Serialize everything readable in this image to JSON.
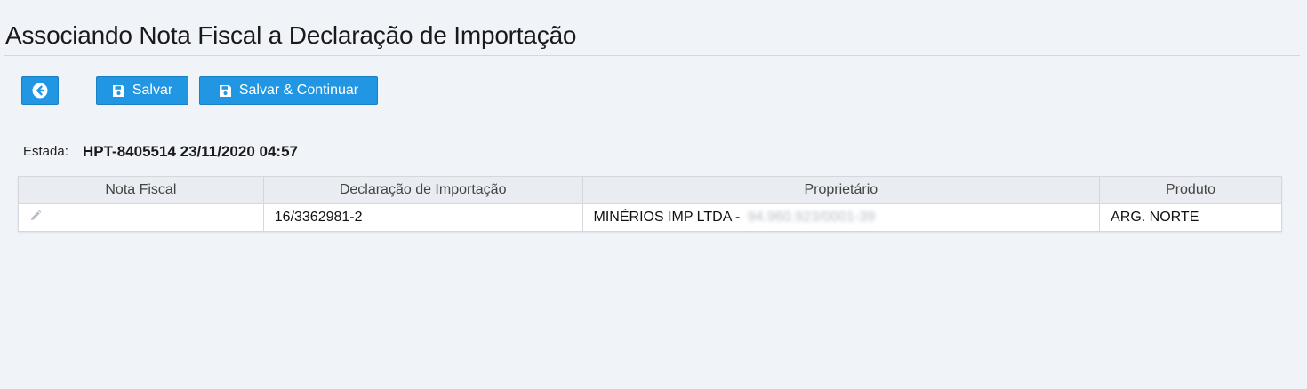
{
  "header": {
    "title": "Associando Nota Fiscal a Declaração de Importação"
  },
  "toolbar": {
    "back_icon": "arrow-left-circle-icon",
    "save_label": "Salvar",
    "save_icon": "floppy-disk-icon",
    "save_continue_label": "Salvar & Continuar",
    "save_continue_icon": "floppy-disk-icon"
  },
  "estada": {
    "label": "Estada:",
    "value": "HPT-8405514 23/11/2020 04:57"
  },
  "table": {
    "columns": [
      "Nota Fiscal",
      "Declaração de Importação",
      "Proprietário",
      "Produto"
    ],
    "rows": [
      {
        "edit_icon": "pencil-icon",
        "nota_fiscal": "",
        "declaracao": "16/3362981-2",
        "proprietario": "MINÉRIOS IMP LTDA -",
        "proprietario_doc": "94.960.923/0001-39",
        "produto": "ARG. NORTE"
      }
    ]
  },
  "colors": {
    "background": "#f0f3f8",
    "button": "#2196e3",
    "header_row": "#e9ecf1"
  }
}
